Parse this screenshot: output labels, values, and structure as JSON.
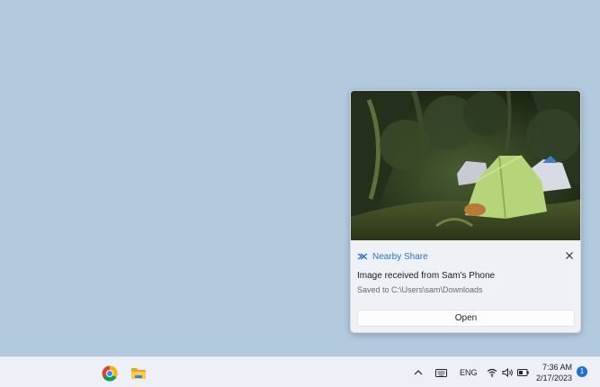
{
  "notification": {
    "app_name": "Nearby Share",
    "title": "Image received from Sam's Phone",
    "body": "Saved to C:\\Users\\sam\\Downloads",
    "open_label": "Open",
    "app_icon": "nearby-share-icon",
    "accent_color": "#2d72c6"
  },
  "taskbar": {
    "pinned_apps": [
      {
        "icon": "chrome-icon"
      },
      {
        "icon": "file-explorer-icon"
      }
    ],
    "tray": {
      "language": "ENG",
      "time": "7:36 AM",
      "date": "2/17/2023",
      "notification_count": "1"
    }
  },
  "colors": {
    "desktop_background": "#b3c9de",
    "taskbar_background": "#edf1f7",
    "badge": "#1f6fd1"
  }
}
